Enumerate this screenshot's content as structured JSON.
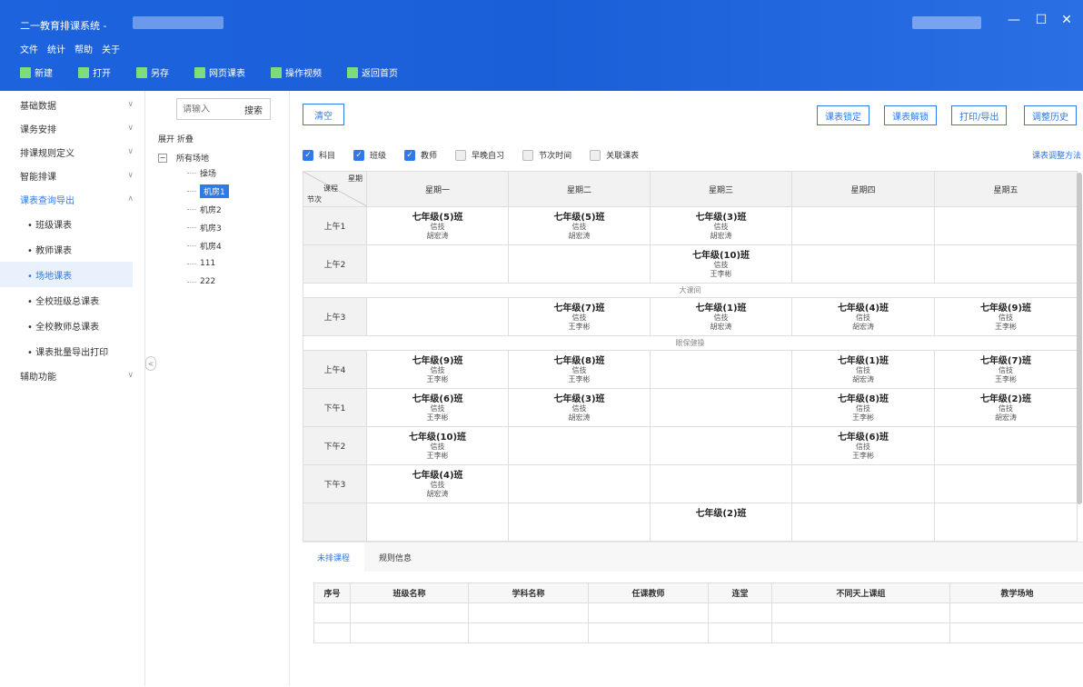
{
  "app": {
    "title": "二一教育排课系统 -"
  },
  "window": {
    "minimize": "—",
    "maximize": "☐",
    "close": "✕"
  },
  "menu": [
    "文件",
    "统计",
    "帮助",
    "关于"
  ],
  "toolbar": [
    {
      "label": "新建",
      "icon": "new-file-icon",
      "color": "#7fdc7a"
    },
    {
      "label": "打开",
      "icon": "folder-icon",
      "color": "#7fdc7a"
    },
    {
      "label": "另存",
      "icon": "save-as-icon",
      "color": "#7fdc7a"
    },
    {
      "label": "网页课表",
      "icon": "web-table-icon",
      "color": "#7fdc7a"
    },
    {
      "label": "操作视频",
      "icon": "video-icon",
      "color": "#7fdc7a"
    },
    {
      "label": "返回首页",
      "icon": "back-arrow-icon",
      "color": "#7fdc7a"
    }
  ],
  "sidebar": {
    "groups": [
      {
        "label": "基础数据",
        "chev": "∨"
      },
      {
        "label": "课务安排",
        "chev": "∨"
      },
      {
        "label": "排课规则定义",
        "chev": "∨"
      },
      {
        "label": "智能排课",
        "chev": "∨"
      },
      {
        "label": "课表查询导出",
        "chev": "∧"
      }
    ],
    "subs": [
      "• 班级课表",
      "• 教师课表",
      "• 场地课表",
      "• 全校班级总课表",
      "• 全校教师总课表",
      "• 课表批量导出打印"
    ],
    "active_sub": 2,
    "last_group": {
      "label": "辅助功能",
      "chev": "∨"
    },
    "collapse": "<"
  },
  "tree": {
    "search_placeholder": "请输入",
    "search_button": "搜索",
    "expand": "展开",
    "collapse": "折叠",
    "root_toggle": "−",
    "root": "所有场地",
    "nodes": [
      "操场",
      "机房1",
      "机房2",
      "机房3",
      "机房4",
      "111",
      "222"
    ],
    "selected": 1
  },
  "main": {
    "clear_button": "清空",
    "right_buttons": [
      "课表锁定",
      "课表解锁",
      "打印/导出",
      "调整历史"
    ],
    "options": [
      {
        "label": "科目",
        "checked": true
      },
      {
        "label": "班级",
        "checked": true
      },
      {
        "label": "教师",
        "checked": true
      },
      {
        "label": "早晚自习",
        "checked": false
      },
      {
        "label": "节次时间",
        "checked": false
      },
      {
        "label": "关联课表",
        "checked": false
      }
    ],
    "adjust_link": "课表调整方法",
    "corner": {
      "day": "星期",
      "course": "课程",
      "period": "节次"
    },
    "days": [
      "星期一",
      "星期二",
      "星期三",
      "星期四",
      "星期五"
    ],
    "rows": [
      {
        "type": "slot",
        "label": "上午1",
        "cells": [
          [
            "七年级(5)班",
            "信技",
            "胡宏涛"
          ],
          [
            "七年级(5)班",
            "信技",
            "胡宏涛"
          ],
          [
            "七年级(3)班",
            "信技",
            "胡宏涛"
          ],
          [],
          []
        ]
      },
      {
        "type": "slot",
        "label": "上午2",
        "cells": [
          [],
          [],
          [
            "七年级(10)班",
            "信技",
            "王李彬"
          ],
          [],
          []
        ]
      },
      {
        "type": "break",
        "label": "大课间"
      },
      {
        "type": "slot",
        "label": "上午3",
        "cells": [
          [],
          [
            "七年级(7)班",
            "信技",
            "王李彬"
          ],
          [
            "七年级(1)班",
            "信技",
            "胡宏涛"
          ],
          [
            "七年级(4)班",
            "信技",
            "胡宏涛"
          ],
          [
            "七年级(9)班",
            "信技",
            "王李彬"
          ]
        ]
      },
      {
        "type": "break",
        "label": "眼保健操"
      },
      {
        "type": "slot",
        "label": "上午4",
        "cells": [
          [
            "七年级(9)班",
            "信技",
            "王李彬"
          ],
          [
            "七年级(8)班",
            "信技",
            "王李彬"
          ],
          [],
          [
            "七年级(1)班",
            "信技",
            "胡宏涛"
          ],
          [
            "七年级(7)班",
            "信技",
            "王李彬"
          ]
        ]
      },
      {
        "type": "slot",
        "label": "下午1",
        "cells": [
          [
            "七年级(6)班",
            "信技",
            "王李彬"
          ],
          [
            "七年级(3)班",
            "信技",
            "胡宏涛"
          ],
          [],
          [
            "七年级(8)班",
            "信技",
            "王李彬"
          ],
          [
            "七年级(2)班",
            "信技",
            "胡宏涛"
          ]
        ]
      },
      {
        "type": "slot",
        "label": "下午2",
        "cells": [
          [
            "七年级(10)班",
            "信技",
            "王李彬"
          ],
          [],
          [],
          [
            "七年级(6)班",
            "信技",
            "王李彬"
          ],
          []
        ]
      },
      {
        "type": "slot",
        "label": "下午3",
        "cells": [
          [
            "七年级(4)班",
            "信技",
            "胡宏涛"
          ],
          [],
          [],
          [],
          []
        ]
      },
      {
        "type": "slot",
        "label": "",
        "cells": [
          [],
          [],
          [
            "七年级(2)班"
          ],
          [],
          []
        ]
      }
    ]
  },
  "bottom": {
    "tabs": [
      "未排课程",
      "规则信息"
    ],
    "active_tab": 0,
    "columns": [
      "序号",
      "班级名称",
      "学科名称",
      "任课教师",
      "连堂",
      "不同天上课组",
      "教学场地"
    ]
  }
}
